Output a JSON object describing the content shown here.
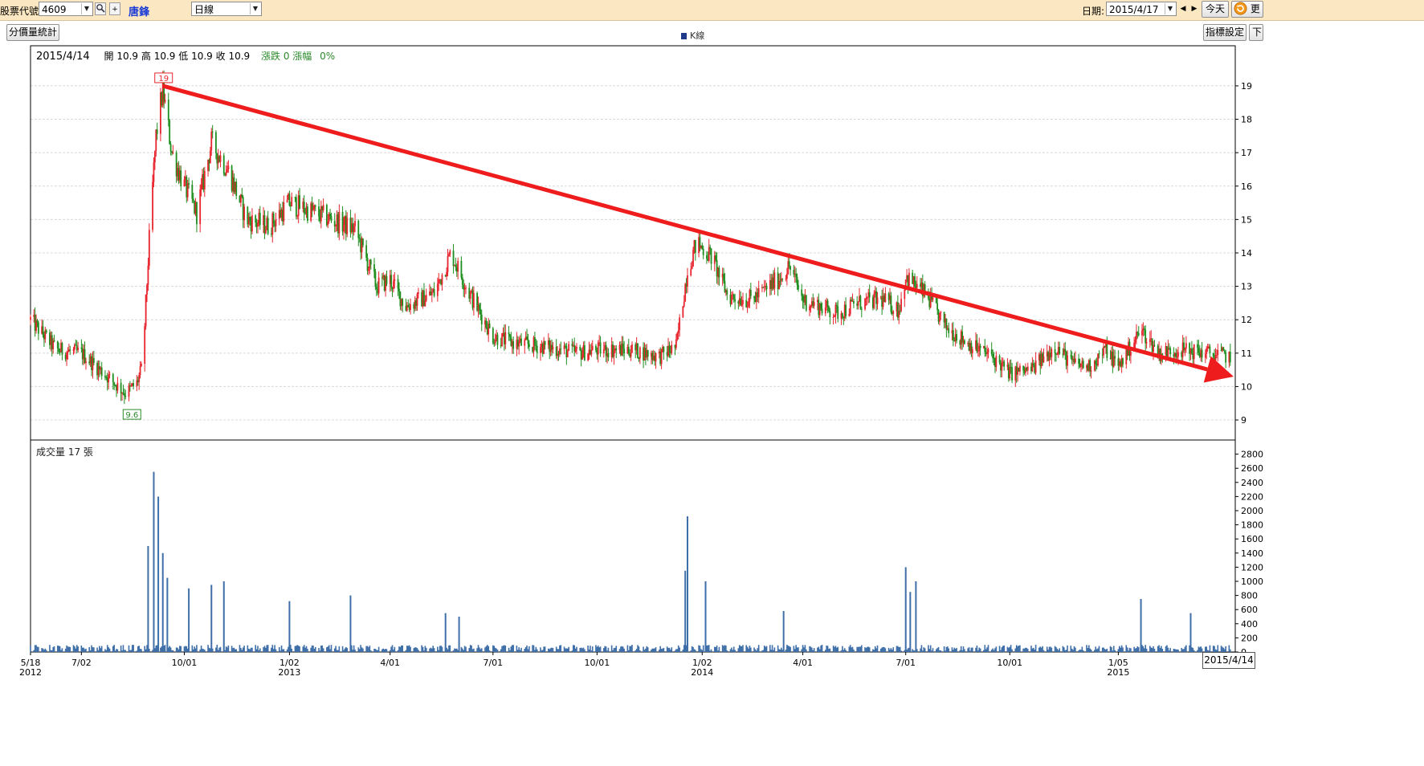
{
  "toolbar": {
    "stock_code_label": "股票代號:",
    "stock_code_value": "4609",
    "stock_name": "唐鋒",
    "period_value": "日線",
    "date_label": "日期:",
    "date_value": "2015/4/17",
    "today_button": "今天",
    "refresh_button": "更",
    "search_icon": "magnifier-icon",
    "add_icon": "plus-icon"
  },
  "buttons": {
    "price_volume_stats": "分價量統計",
    "indicator_settings": "指標設定",
    "down_button": "下"
  },
  "legend": {
    "kline": "K線"
  },
  "info_bar": {
    "date": "2015/4/14",
    "open": "開 10.9",
    "high": "高 10.9",
    "low": "低 10.9",
    "close": "收 10.9",
    "change": "漲跌 0",
    "pct": "漲幅",
    "pct_value": "0%"
  },
  "volume_label": "成交量 17 張",
  "cursor_date": "2015/4/14",
  "colors": {
    "up": "#e8252e",
    "down": "#1e8e1e",
    "volume": "#3f6fa8",
    "trendline": "#ee1c1c"
  },
  "chart_data": [
    {
      "type": "candlestick",
      "title": "",
      "ylim": [
        8.4,
        20.2
      ],
      "y_ticks": [
        "9",
        "10",
        "11",
        "12",
        "13",
        "14",
        "15",
        "16",
        "17",
        "18",
        "19"
      ],
      "x_labels": [
        {
          "label": "5/18",
          "year": "2012",
          "date": "2012-05-18"
        },
        {
          "label": "7/02",
          "date": "2012-07-02"
        },
        {
          "label": "10/01",
          "date": "2012-10-01"
        },
        {
          "label": "1/02",
          "year": "2013",
          "date": "2013-01-02"
        },
        {
          "label": "4/01",
          "date": "2013-04-01"
        },
        {
          "label": "7/01",
          "date": "2013-07-01"
        },
        {
          "label": "10/01",
          "date": "2013-10-01"
        },
        {
          "label": "1/02",
          "year": "2014",
          "date": "2014-01-02"
        },
        {
          "label": "4/01",
          "date": "2014-04-01"
        },
        {
          "label": "7/01",
          "date": "2014-07-01"
        },
        {
          "label": "10/01",
          "date": "2014-10-01"
        },
        {
          "label": "1/05",
          "year": "2015",
          "date": "2015-01-05"
        }
      ],
      "close_path": [
        {
          "date": "2012-05-18",
          "close": 12.0
        },
        {
          "date": "2012-06-10",
          "close": 11.1
        },
        {
          "date": "2012-07-02",
          "close": 11.0
        },
        {
          "date": "2012-07-25",
          "close": 10.3
        },
        {
          "date": "2012-08-10",
          "close": 9.8
        },
        {
          "date": "2012-08-20",
          "close": 10.1
        },
        {
          "date": "2012-08-25",
          "close": 10.6
        },
        {
          "date": "2012-09-01",
          "close": 15.0
        },
        {
          "date": "2012-09-06",
          "close": 17.5
        },
        {
          "date": "2012-09-12",
          "close": 18.9
        },
        {
          "date": "2012-09-20",
          "close": 17.0
        },
        {
          "date": "2012-10-01",
          "close": 16.0
        },
        {
          "date": "2012-10-12",
          "close": 15.2
        },
        {
          "date": "2012-10-25",
          "close": 17.3
        },
        {
          "date": "2012-11-10",
          "close": 16.4
        },
        {
          "date": "2012-11-25",
          "close": 15.0
        },
        {
          "date": "2012-12-15",
          "close": 14.8
        },
        {
          "date": "2013-01-02",
          "close": 15.5
        },
        {
          "date": "2013-02-01",
          "close": 15.1
        },
        {
          "date": "2013-03-01",
          "close": 14.7
        },
        {
          "date": "2013-03-20",
          "close": 13.0
        },
        {
          "date": "2013-04-01",
          "close": 13.2
        },
        {
          "date": "2013-04-15",
          "close": 12.4
        },
        {
          "date": "2013-05-10",
          "close": 12.8
        },
        {
          "date": "2013-05-25",
          "close": 14.0
        },
        {
          "date": "2013-06-10",
          "close": 12.8
        },
        {
          "date": "2013-07-01",
          "close": 11.5
        },
        {
          "date": "2013-07-20",
          "close": 11.3
        },
        {
          "date": "2013-08-15",
          "close": 11.2
        },
        {
          "date": "2013-09-15",
          "close": 11.0
        },
        {
          "date": "2013-10-01",
          "close": 11.1
        },
        {
          "date": "2013-11-01",
          "close": 11.1
        },
        {
          "date": "2013-11-25",
          "close": 10.9
        },
        {
          "date": "2013-12-10",
          "close": 11.2
        },
        {
          "date": "2013-12-20",
          "close": 13.5
        },
        {
          "date": "2013-12-28",
          "close": 14.3
        },
        {
          "date": "2014-01-10",
          "close": 13.9
        },
        {
          "date": "2014-01-25",
          "close": 12.7
        },
        {
          "date": "2014-02-15",
          "close": 12.6
        },
        {
          "date": "2014-03-10",
          "close": 13.2
        },
        {
          "date": "2014-03-20",
          "close": 13.6
        },
        {
          "date": "2014-04-01",
          "close": 12.6
        },
        {
          "date": "2014-05-01",
          "close": 12.2
        },
        {
          "date": "2014-05-20",
          "close": 12.5
        },
        {
          "date": "2014-06-10",
          "close": 12.6
        },
        {
          "date": "2014-06-25",
          "close": 12.3
        },
        {
          "date": "2014-07-01",
          "close": 13.3
        },
        {
          "date": "2014-07-20",
          "close": 12.7
        },
        {
          "date": "2014-08-05",
          "close": 11.8
        },
        {
          "date": "2014-08-25",
          "close": 11.3
        },
        {
          "date": "2014-09-15",
          "close": 10.9
        },
        {
          "date": "2014-10-01",
          "close": 10.4
        },
        {
          "date": "2014-10-20",
          "close": 10.5
        },
        {
          "date": "2014-11-10",
          "close": 11.2
        },
        {
          "date": "2014-11-25",
          "close": 10.7
        },
        {
          "date": "2014-12-10",
          "close": 10.6
        },
        {
          "date": "2014-12-25",
          "close": 11.1
        },
        {
          "date": "2015-01-05",
          "close": 10.6
        },
        {
          "date": "2015-01-25",
          "close": 11.7
        },
        {
          "date": "2015-02-10",
          "close": 11.0
        },
        {
          "date": "2015-03-01",
          "close": 11.1
        },
        {
          "date": "2015-03-25",
          "close": 11.0
        },
        {
          "date": "2015-04-14",
          "close": 10.9
        }
      ],
      "annotations": [
        {
          "text": "19",
          "date": "2012-09-12",
          "value": 19.0,
          "kind": "high"
        },
        {
          "text": "9.6",
          "date": "2012-08-15",
          "value": 9.6,
          "kind": "low"
        }
      ],
      "trendline": {
        "from": {
          "date": "2012-09-12",
          "value": 19.0
        },
        "to": {
          "date": "2015-04-17",
          "value": 10.3
        }
      },
      "grid": true
    },
    {
      "type": "bar",
      "title": "",
      "ylim": [
        0,
        3000
      ],
      "y_ticks": [
        "0",
        "200",
        "400",
        "600",
        "800",
        "1000",
        "1200",
        "1400",
        "1600",
        "1800",
        "2000",
        "2200",
        "2400",
        "2600",
        "2800"
      ],
      "spikes": [
        {
          "date": "2012-08-30",
          "value": 1500
        },
        {
          "date": "2012-09-04",
          "value": 2550
        },
        {
          "date": "2012-09-08",
          "value": 2200
        },
        {
          "date": "2012-09-12",
          "value": 1400
        },
        {
          "date": "2012-09-16",
          "value": 1050
        },
        {
          "date": "2012-10-05",
          "value": 900
        },
        {
          "date": "2012-10-25",
          "value": 950
        },
        {
          "date": "2012-11-05",
          "value": 1000
        },
        {
          "date": "2013-01-02",
          "value": 720
        },
        {
          "date": "2013-02-25",
          "value": 800
        },
        {
          "date": "2013-05-20",
          "value": 550
        },
        {
          "date": "2013-06-01",
          "value": 500
        },
        {
          "date": "2013-12-20",
          "value": 1920
        },
        {
          "date": "2013-12-18",
          "value": 1150
        },
        {
          "date": "2014-01-05",
          "value": 1000
        },
        {
          "date": "2014-03-15",
          "value": 580
        },
        {
          "date": "2014-07-01",
          "value": 1200
        },
        {
          "date": "2014-07-05",
          "value": 850
        },
        {
          "date": "2014-07-10",
          "value": 1000
        },
        {
          "date": "2015-01-25",
          "value": 750
        },
        {
          "date": "2015-03-10",
          "value": 550
        }
      ],
      "baseline_volume": 60,
      "grid": false
    }
  ]
}
